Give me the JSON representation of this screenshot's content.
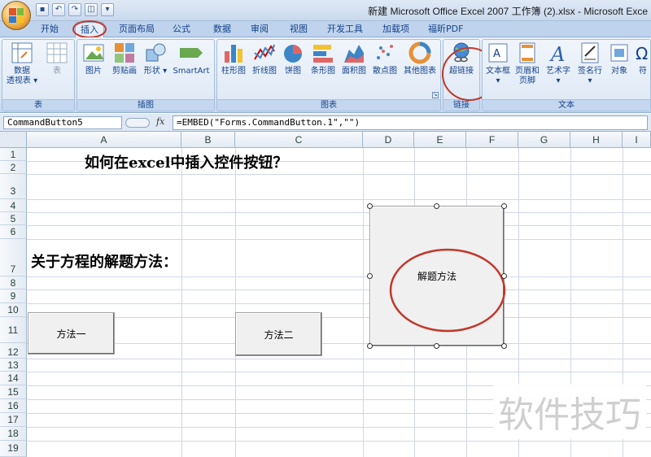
{
  "window": {
    "title": "新建 Microsoft Office Excel 2007 工作簿 (2).xlsx - Microsoft Exce"
  },
  "tabs": [
    "开始",
    "插入",
    "页面布局",
    "公式",
    "数据",
    "审阅",
    "视图",
    "开发工具",
    "加载项",
    "福昕PDF"
  ],
  "active_tab": "插入",
  "ribbon": {
    "groups": {
      "table": "表",
      "illustrations": "插图",
      "charts": "图表",
      "links": "链接",
      "text": "文本"
    },
    "buttons": {
      "pivot_line1": "数据",
      "pivot_line2": "透视表",
      "table": "表",
      "picture": "图片",
      "clipart": "剪贴画",
      "shapes": "形状",
      "smartart": "SmartArt",
      "column": "柱形图",
      "line": "折线图",
      "pie": "饼图",
      "bar": "条形图",
      "area": "面积图",
      "scatter": "散点图",
      "other_charts": "其他图表",
      "hyperlink": "超链接",
      "textbox": "文本框",
      "header_line1": "页眉和",
      "header_line2": "页脚",
      "wordart": "艺术字",
      "signature": "签名行",
      "object": "对象",
      "symbol": "符"
    }
  },
  "formula_bar": {
    "name_box": "CommandButton5",
    "fx": "fx",
    "formula": "=EMBED(\"Forms.CommandButton.1\",\"\")"
  },
  "columns": [
    "A",
    "B",
    "C",
    "D",
    "E",
    "F",
    "G",
    "H",
    "I"
  ],
  "rows": [
    "1",
    "2",
    "3",
    "4",
    "5",
    "6",
    "7",
    "8",
    "9",
    "10",
    "11",
    "12",
    "13",
    "14",
    "15",
    "16",
    "17",
    "18",
    "19"
  ],
  "sheet": {
    "title": "如何在excel中插入控件按钮？",
    "subtitle": "关于方程的解题方法：",
    "button1": "方法一",
    "button2": "方法二",
    "button3": "解题方法"
  },
  "watermark": "软件技巧",
  "colors": {
    "highlight_circle": "#c0392b",
    "ribbon_text": "#15428b"
  }
}
